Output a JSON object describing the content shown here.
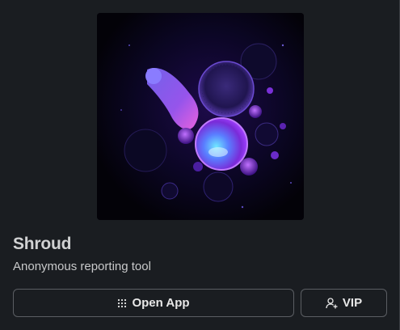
{
  "app": {
    "name": "Shroud",
    "description": "Anonymous reporting tool",
    "image_icon": "purple-bubbles-artwork"
  },
  "actions": {
    "open_app_label": "Open App",
    "open_app_icon": "apps-grid-icon",
    "vip_label": "VIP",
    "vip_icon": "add-user-icon"
  },
  "colors": {
    "background": "#1a1d21",
    "text": "#d1d2d3",
    "button_border": "#5b5e63",
    "accent_purple": "#7b3cff"
  }
}
